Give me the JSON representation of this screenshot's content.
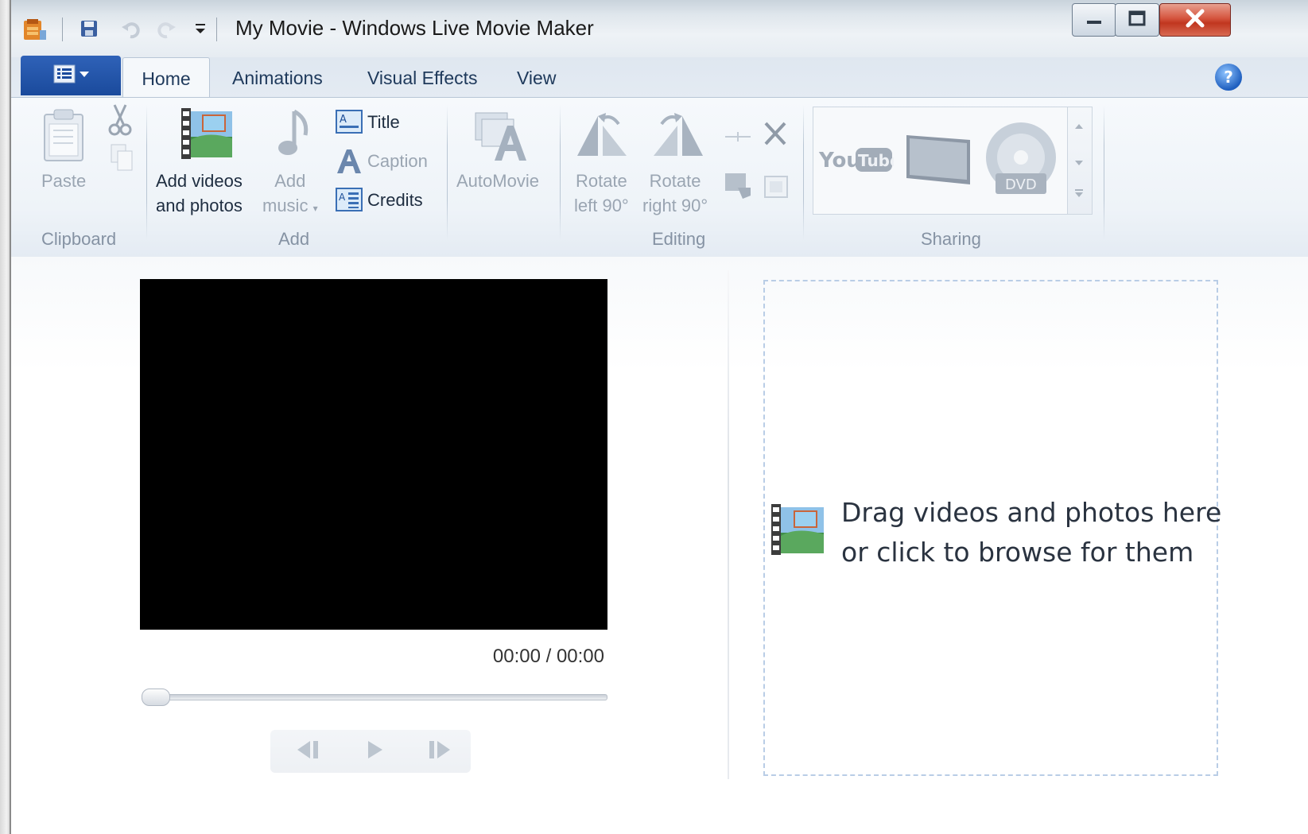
{
  "window": {
    "title": "My Movie - Windows Live Movie Maker"
  },
  "quick_access": {
    "icons": [
      "app-icon",
      "save-icon",
      "undo-icon",
      "redo-icon",
      "customize-dropdown-icon"
    ]
  },
  "caption_buttons": [
    "minimize-icon",
    "maximize-icon",
    "close-icon"
  ],
  "tabs": [
    {
      "label": "Home",
      "selected": true
    },
    {
      "label": "Animations",
      "selected": false
    },
    {
      "label": "Visual Effects",
      "selected": false
    },
    {
      "label": "View",
      "selected": false
    }
  ],
  "ribbon": {
    "clipboard": {
      "group_label": "Clipboard",
      "paste_label": "Paste",
      "cut_icon": "scissors-icon",
      "copy_icon": "copy-icon"
    },
    "add": {
      "group_label": "Add",
      "add_videos_line1": "Add videos",
      "add_videos_line2": "and photos",
      "add_music_line1": "Add",
      "add_music_line2": "music",
      "title_label": "Title",
      "caption_label": "Caption",
      "credits_label": "Credits"
    },
    "automovie": {
      "label": "AutoMovie"
    },
    "editing": {
      "group_label": "Editing",
      "rotate_left_line1": "Rotate",
      "rotate_left_line2": "left 90°",
      "rotate_right_line1": "Rotate",
      "rotate_right_line2": "right 90°"
    },
    "sharing": {
      "group_label": "Sharing",
      "items": [
        "youtube-icon",
        "tv-icon",
        "dvd-icon"
      ],
      "youtube_logo_text": "YouTube",
      "dvd_text": "DVD"
    }
  },
  "player": {
    "time": "00:00 / 00:00",
    "progress": 0
  },
  "storyboard": {
    "hint_line1": "Drag videos and photos here",
    "hint_line2": "or click to browse for them"
  },
  "colors": {
    "file_menu": "#1a4a9c",
    "close_button": "#c0361f",
    "preview_background": "#000000",
    "drop_zone_border": "#b9cde6"
  }
}
